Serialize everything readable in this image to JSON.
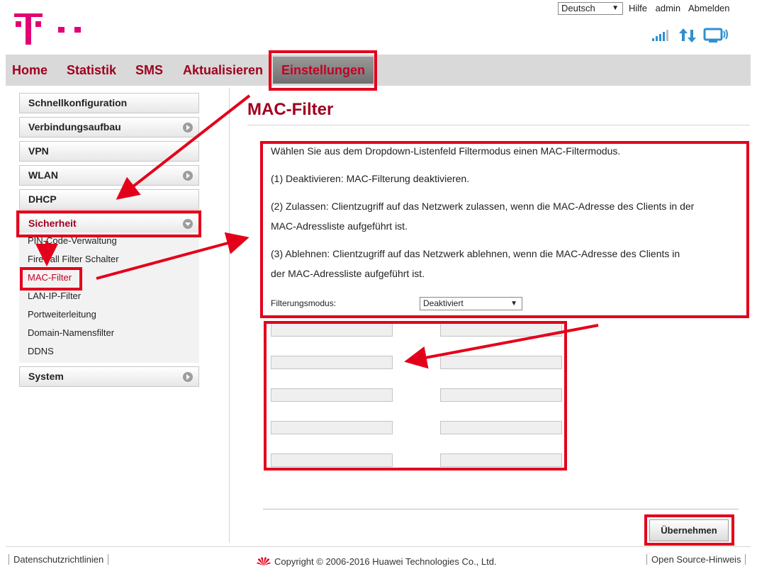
{
  "header": {
    "language": "Deutsch",
    "links": [
      "Hilfe",
      "admin",
      "Abmelden"
    ]
  },
  "nav": {
    "items": [
      "Home",
      "Statistik",
      "SMS",
      "Aktualisieren",
      "Einstellungen"
    ],
    "active": "Einstellungen"
  },
  "sidebar": {
    "items": [
      "Schnellkonfiguration",
      "Verbindungsaufbau",
      "VPN",
      "WLAN",
      "DHCP",
      "Sicherheit",
      "System"
    ],
    "submenu": [
      "PIN-Code-Verwaltung",
      "Firewall Filter Schalter",
      "MAC-Filter",
      "LAN-IP-Filter",
      "Portweiterleitung",
      "Domain-Namensfilter",
      "DDNS"
    ]
  },
  "content": {
    "title": "MAC-Filter",
    "intro": "Wählen Sie aus dem Dropdown-Listenfeld Filtermodus einen MAC-Filtermodus.",
    "item1": "(1) Deaktivieren: MAC-Filterung deaktivieren.",
    "item2_line1": "(2) Zulassen: Clientzugriff auf das Netzwerk zulassen, wenn die MAC-Adresse des Clients in der",
    "item2_line2": "MAC-Adressliste aufgeführt ist.",
    "item3_line1": "(3) Ablehnen: Clientzugriff auf das Netzwerk ablehnen, wenn die MAC-Adresse des Clients in",
    "item3_line2": "der MAC-Adressliste aufgeführt ist.",
    "filter_label": "Filterungsmodus:",
    "filter_value": "Deaktiviert",
    "mac_addresses": [
      "",
      "",
      "",
      "",
      "",
      "",
      "",
      "",
      "",
      ""
    ],
    "apply_label": "Übernehmen"
  },
  "footer": {
    "privacy": "Datenschutzrichtlinien",
    "copyright": "Copyright © 2006-2016 Huawei Technologies Co., Ltd.",
    "opensource": "Open Source-Hinweis"
  },
  "colors": {
    "brand": "#e20074",
    "accent": "#a0001e",
    "annotation": "#e3001b"
  },
  "icons": [
    "telekom-logo-icon",
    "signal-strength-icon",
    "data-transfer-icon",
    "monitor-icon",
    "huawei-logo-icon"
  ]
}
